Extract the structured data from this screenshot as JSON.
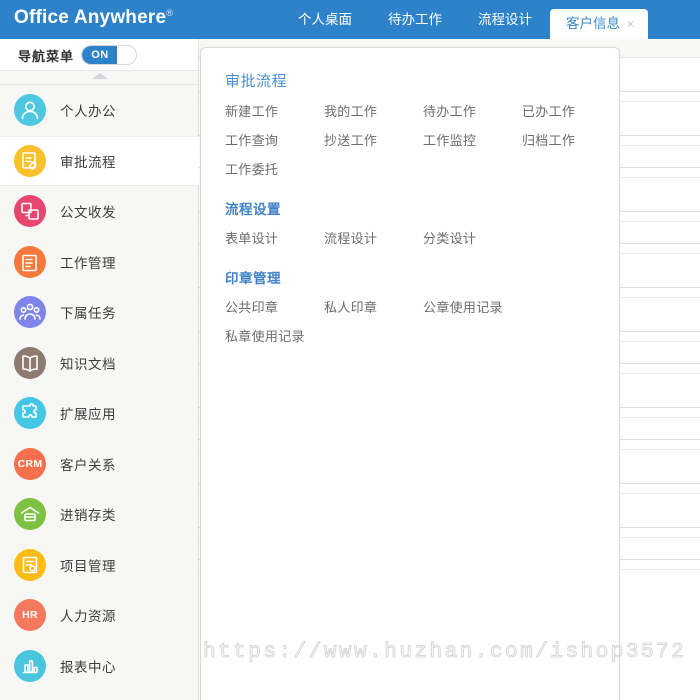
{
  "header": {
    "logo_text": "Office Anywhere",
    "registered_mark": "®",
    "brand_color": "#2d82c9",
    "tabs": [
      {
        "label": "个人桌面",
        "active": false,
        "closable": false
      },
      {
        "label": "待办工作",
        "active": false,
        "closable": false
      },
      {
        "label": "流程设计",
        "active": false,
        "closable": false
      },
      {
        "label": "客户信息",
        "active": true,
        "closable": true,
        "close_glyph": "×"
      }
    ]
  },
  "sidebar": {
    "toggle": {
      "label": "导航菜单",
      "state_text": "ON",
      "on": true
    },
    "items": [
      {
        "label": "个人办公",
        "icon": "person-icon",
        "color": "#4ec8e0",
        "active": false
      },
      {
        "label": "审批流程",
        "icon": "approval-icon",
        "color": "#fbc02d",
        "active": true
      },
      {
        "label": "公文收发",
        "icon": "document-icon",
        "color": "#e8456f",
        "active": false
      },
      {
        "label": "工作管理",
        "icon": "clipboard-icon",
        "color": "#f4793b",
        "active": false
      },
      {
        "label": "下属任务",
        "icon": "team-icon",
        "color": "#7f85e8",
        "active": false
      },
      {
        "label": "知识文档",
        "icon": "book-icon",
        "color": "#8d7b72",
        "active": false
      },
      {
        "label": "扩展应用",
        "icon": "puzzle-icon",
        "color": "#45c6e4",
        "active": false
      },
      {
        "label": "客户关系",
        "icon": "crm-icon",
        "color": "#f4704e",
        "active": false,
        "badge_text": "CRM"
      },
      {
        "label": "进销存类",
        "icon": "warehouse-icon",
        "color": "#7dc242",
        "active": false
      },
      {
        "label": "项目管理",
        "icon": "project-icon",
        "color": "#fbbc16",
        "active": false
      },
      {
        "label": "人力资源",
        "icon": "hr-icon",
        "color": "#f4795f",
        "active": false,
        "badge_text": "HR"
      },
      {
        "label": "报表中心",
        "icon": "chart-icon",
        "color": "#4bc4de",
        "active": false
      }
    ]
  },
  "dropdown_panel": {
    "groups": [
      {
        "title": "审批流程",
        "title_style": "light",
        "columns": 4,
        "links": [
          "新建工作",
          "我的工作",
          "待办工作",
          "已办工作",
          "工作查询",
          "抄送工作",
          "工作监控",
          "归档工作",
          "工作委托"
        ]
      },
      {
        "title": "流程设置",
        "title_style": "bold",
        "columns": 3,
        "links": [
          "表单设计",
          "流程设计",
          "分类设计"
        ]
      },
      {
        "title": "印章管理",
        "title_style": "bold",
        "columns": 3,
        "links": [
          "公共印章",
          "私人印章",
          "公章使用记录",
          "私章使用记录"
        ]
      }
    ]
  },
  "watermark": {
    "text": "https://www.huzhan.com/ishop3572"
  }
}
